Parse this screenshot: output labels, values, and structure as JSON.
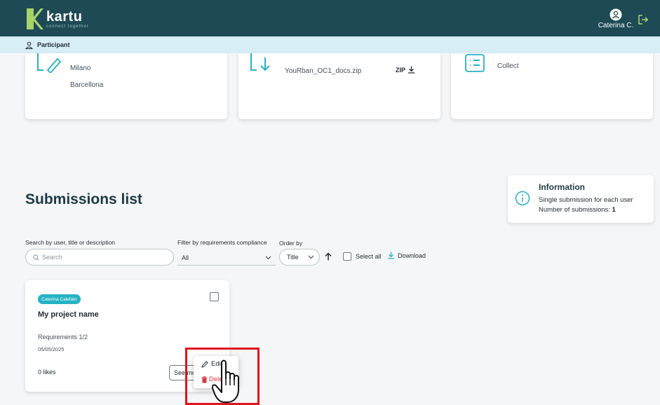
{
  "header": {
    "logo_text": "kartu",
    "logo_tagline": "connect together",
    "user_name": "Caterina C.",
    "icons": [
      "user-avatar-icon",
      "logout-icon"
    ],
    "bg_color": "#1d4a55"
  },
  "role_bar": {
    "label": "Participant",
    "icon": "user-icon"
  },
  "top_cards": {
    "locations": [
      "Milano",
      "Barcellona"
    ],
    "document": {
      "file_name": "YouRban_OC1_docs.zip",
      "format": "ZIP"
    },
    "collect_label": "Collect"
  },
  "submissions": {
    "title": "Submissions list",
    "info": {
      "title": "Information",
      "line1": "Single submission for each user",
      "line2_label": "Number of submissions: ",
      "line2_value": "1"
    },
    "search": {
      "label": "Search by user, title or description",
      "placeholder": "Search"
    },
    "filter": {
      "label": "Filter by requirements compliance",
      "value": "All"
    },
    "order": {
      "label": "Order by",
      "value": "Title"
    },
    "select_all_label": "Select all",
    "download_label": "Download",
    "card": {
      "author": "Caterina Calefato",
      "project_name": "My project name",
      "requirements": "Requirements 1/2",
      "date": "05/05/2025",
      "likes": "0 likes",
      "see_more_label": "See mo"
    },
    "menu": {
      "edit_label": "Edit",
      "delete_label": "Delete"
    }
  },
  "colors": {
    "accent": "#25b3c4",
    "highlight": "#e0141c",
    "danger": "#d9363e"
  }
}
